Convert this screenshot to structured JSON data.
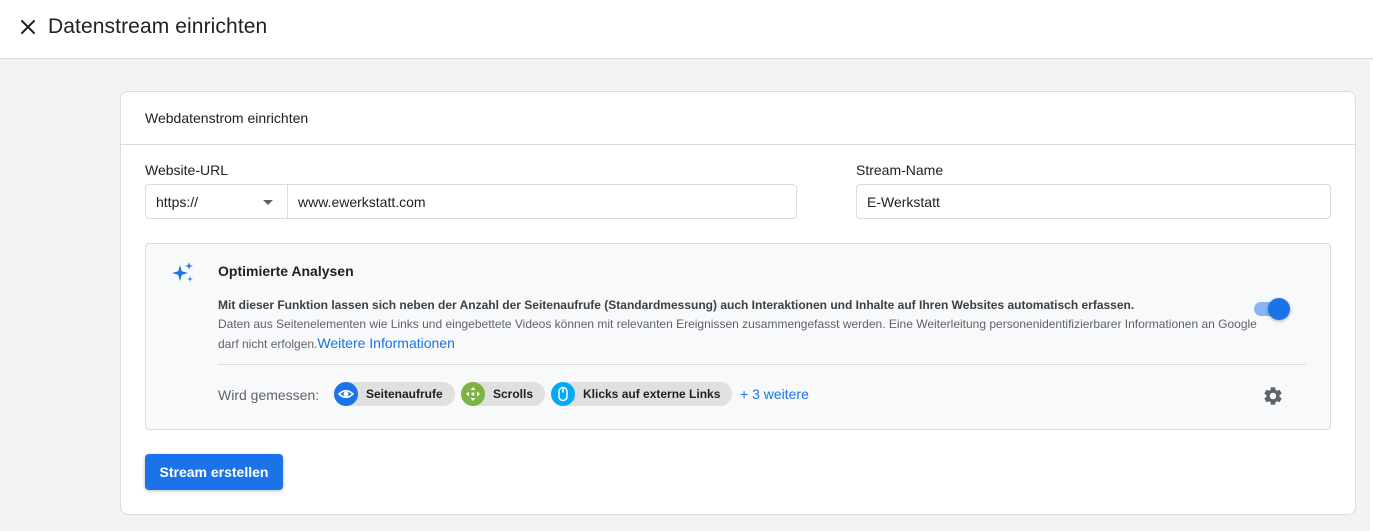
{
  "header": {
    "close_icon": "close-icon",
    "title": "Datenstream einrichten"
  },
  "card": {
    "title": "Webdatenstrom einrichten",
    "website_url": {
      "label": "Website-URL",
      "protocol": "https://",
      "value": "www.ewerkstatt.com"
    },
    "stream_name": {
      "label": "Stream-Name",
      "value": "E-Werkstatt"
    },
    "enhanced_measurement": {
      "icon": "sparkle-icon",
      "title": "Optimierte Analysen",
      "desc_line1": "Mit dieser Funktion lassen sich neben der Anzahl der Seitenaufrufe (Standardmessung) auch Interaktionen und Inhalte auf Ihren Websites automatisch erfassen.",
      "desc_line2": "Daten aus Seitenelementen wie Links und eingebettete Videos können mit relevanten Ereignissen zusammengefasst werden. Eine Weiterleitung personenidentifizierbarer Informationen an Google darf nicht erfolgen.",
      "learn_more": "Weitere Informationen",
      "toggle_on": true,
      "measured_label": "Wird gemessen:",
      "chips": [
        {
          "label": "Seitenaufrufe",
          "icon": "eye-icon",
          "color": "#1a73e8"
        },
        {
          "label": "Scrolls",
          "icon": "scroll-arrows-icon",
          "color": "#7cb342"
        },
        {
          "label": "Klicks auf externe Links",
          "icon": "mouse-icon",
          "color": "#03a9f4"
        }
      ],
      "more": "+ 3 weitere",
      "settings_icon": "gear-icon"
    },
    "create_button": "Stream erstellen"
  },
  "colors": {
    "accent": "#1a73e8",
    "background": "#f1f3f4",
    "border": "#dadce0"
  }
}
